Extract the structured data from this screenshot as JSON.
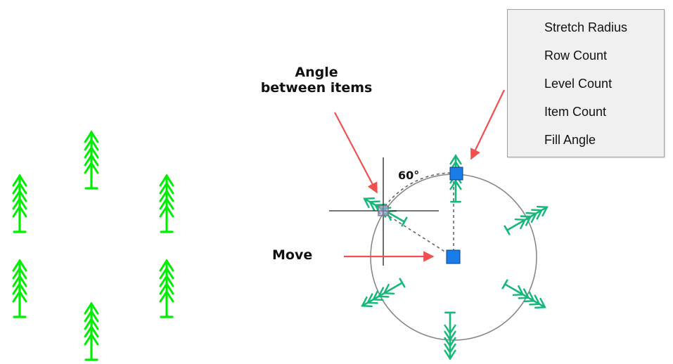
{
  "annotations": {
    "angle_between_items": [
      "Angle",
      "between items"
    ],
    "move": "Move",
    "angle_value": "60°"
  },
  "context_menu": {
    "items": [
      {
        "label": "Stretch Radius"
      },
      {
        "label": "Row Count"
      },
      {
        "label": "Level Count"
      },
      {
        "label": "Item Count"
      },
      {
        "label": "Fill Angle"
      }
    ]
  },
  "colors": {
    "tree_bright_green": "#00ee00",
    "tree_teal_green": "#16b87a",
    "grip_blue": "#1a7ce8",
    "annotation_arrow": "#f05050",
    "circle_gray": "#888888"
  },
  "icons": {
    "array_item": "tree-icon",
    "grip": "grip-square-icon",
    "cursor": "crosshair-icon"
  }
}
